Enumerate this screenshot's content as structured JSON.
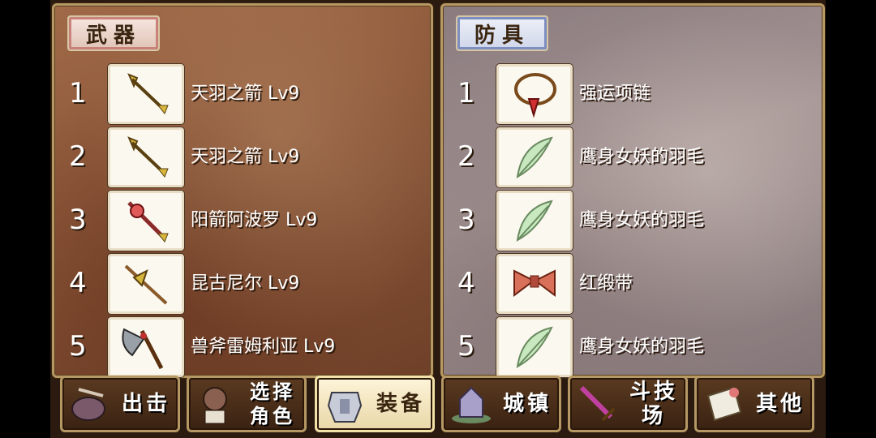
{
  "weapons_panel": {
    "title": "武器",
    "items": [
      {
        "num": "1",
        "name": "天羽之箭 Lv9"
      },
      {
        "num": "2",
        "name": "天羽之箭 Lv9"
      },
      {
        "num": "3",
        "name": "阳箭阿波罗 Lv9"
      },
      {
        "num": "4",
        "name": "昆古尼尔 Lv9"
      },
      {
        "num": "5",
        "name": "兽斧雷姆利亚 Lv9"
      }
    ]
  },
  "armor_panel": {
    "title": "防具",
    "items": [
      {
        "num": "1",
        "name": "强运项链"
      },
      {
        "num": "2",
        "name": "鹰身女妖的羽毛"
      },
      {
        "num": "3",
        "name": "鹰身女妖的羽毛"
      },
      {
        "num": "4",
        "name": "红缎带"
      },
      {
        "num": "5",
        "name": "鹰身女妖的羽毛"
      }
    ]
  },
  "tabs": [
    {
      "label": "出击"
    },
    {
      "label_line1": "选择",
      "label_line2": "角色"
    },
    {
      "label": "装备"
    },
    {
      "label": "城镇"
    },
    {
      "label": "斗技场"
    },
    {
      "label": "其他"
    }
  ],
  "active_tab": "装备"
}
